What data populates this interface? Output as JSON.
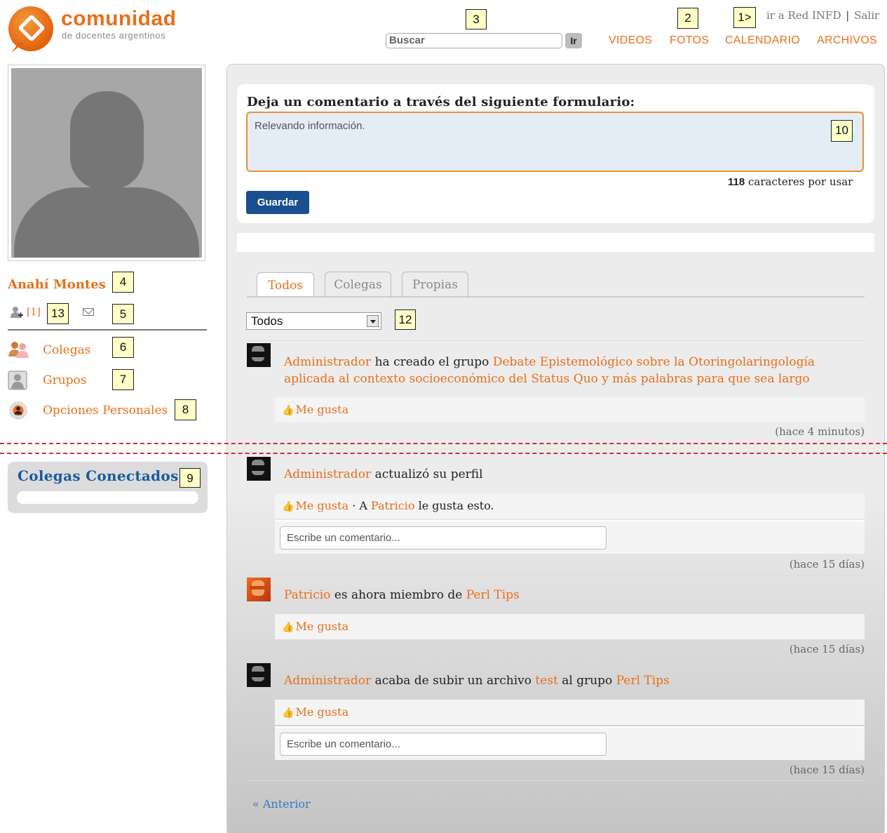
{
  "header": {
    "logo_title": "comunidad",
    "logo_subtitle": "de docentes argentinos",
    "search_placeholder": "Buscar",
    "search_button": "Ir",
    "red_link": "ir a Red INFD",
    "separator": "|",
    "logout": "Salir",
    "nav": [
      "VIDEOS",
      "FOTOS",
      "CALENDARIO",
      "ARCHIVOS"
    ]
  },
  "annotations": {
    "t1": "1>",
    "t2": "2",
    "t3": "3",
    "t4": "4",
    "t5": "5",
    "t6": "6",
    "t7": "7",
    "t8": "8",
    "t9": "9",
    "t10": "10",
    "t12": "12",
    "t13": "13"
  },
  "sidebar": {
    "name": "Anahí Montes",
    "friend_requests": "[1]",
    "menu": [
      "Colegas",
      "Grupos",
      "Opciones Personales"
    ],
    "online_title": "Colegas Conectados"
  },
  "form": {
    "heading": "Deja un comentario a través del siguiente formulario:",
    "comment_value": "Relevando información.",
    "char_count": "118",
    "char_suffix": "caracteres por usar",
    "save_button": "Guardar"
  },
  "tabs": [
    "Todos",
    "Colegas",
    "Propias"
  ],
  "filter": {
    "selected": "Todos"
  },
  "feed": [
    {
      "user": "Administrador",
      "action": "ha creado el grupo",
      "link1": "Debate Epistemológico sobre la Otoringolaringología",
      "link1_cont": "aplicada al contexto socioeconómico del Status Quo y más palabras para que sea largo",
      "like": "Me gusta",
      "time": "(hace 4 minutos)"
    },
    {
      "user": "Administrador",
      "action": "actualizó su perfil",
      "like": "Me gusta",
      "like_extra_pre": " · A ",
      "liker": "Patricio",
      "like_extra_post": " le gusta esto.",
      "comment_placeholder": "Escribe un comentario...",
      "time": "(hace 15 días)"
    },
    {
      "user": "Patricio",
      "action": "es ahora miembro de",
      "link1": "Perl Tips",
      "like": "Me gusta",
      "time": "(hace 15 días)"
    },
    {
      "user": "Administrador",
      "action": "acaba de subir un archivo",
      "link1": "test",
      "mid": "al grupo",
      "link2": "Perl Tips",
      "like": "Me gusta",
      "comment_placeholder": "Escribe un comentario...",
      "time": "(hace 15 días)"
    }
  ],
  "pagination": {
    "prev": "« Anterior"
  },
  "colors": {
    "accent": "#e8701a",
    "link_blue": "#1a5c9e",
    "button_blue": "#1a4f8f",
    "fold_line": "#d03030"
  }
}
